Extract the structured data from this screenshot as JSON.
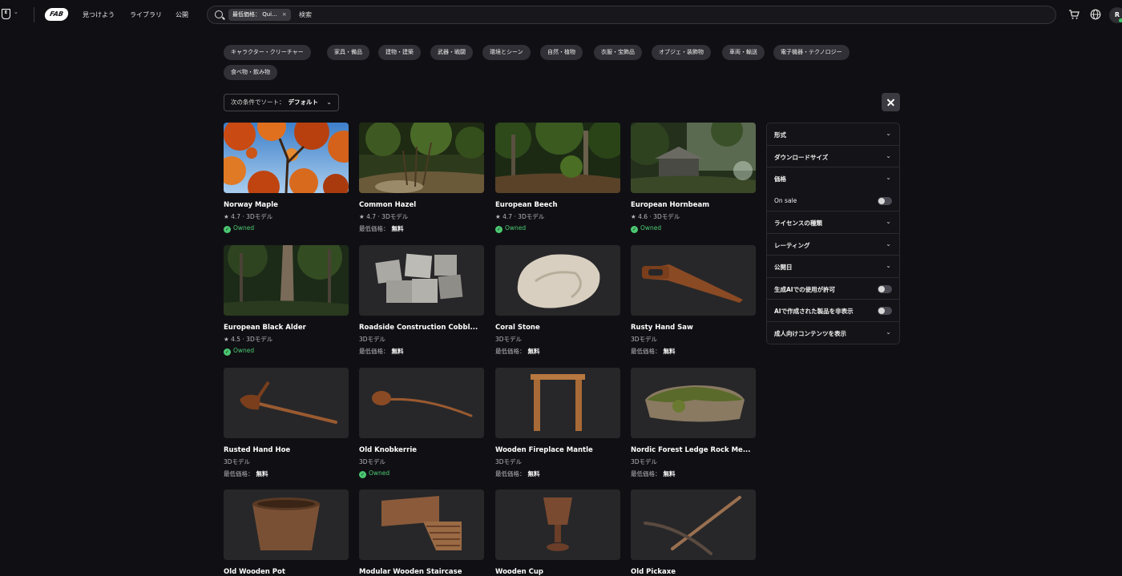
{
  "topbar": {
    "nav": [
      "見つけよう",
      "ライブラリ",
      "公開"
    ],
    "search_chip": "最低価格： Qui...",
    "search_chip_close": "×",
    "search_placeholder": "検索",
    "avatar_letter": "R",
    "logo_text": "FAB"
  },
  "categories": [
    "キャラクター・クリーチャー",
    "家具・備品",
    "建物・建築",
    "武器・戦闘",
    "環境とシーン",
    "自然・植物",
    "衣服・宝飾品",
    "オブジェ・装飾物",
    "車両・輸送",
    "電子機器・テクノロジー",
    "食べ物・飲み物"
  ],
  "sort": {
    "label": "次の条件でソート：",
    "value": "デフォルト"
  },
  "cards": [
    {
      "title": "Norway Maple",
      "meta": "★ 4.7 · 3Dモデル",
      "status": "owned",
      "status_text": "Owned"
    },
    {
      "title": "Common Hazel",
      "meta": "★ 4.7 · 3Dモデル",
      "status": "price",
      "price_label": "最低価格：",
      "price": "無料"
    },
    {
      "title": "European Beech",
      "meta": "★ 4.7 · 3Dモデル",
      "status": "owned",
      "status_text": "Owned"
    },
    {
      "title": "European Hornbeam",
      "meta": "★ 4.6 · 3Dモデル",
      "status": "owned",
      "status_text": "Owned"
    },
    {
      "title": "European Black Alder",
      "meta": "★ 4.5 · 3Dモデル",
      "status": "owned",
      "status_text": "Owned"
    },
    {
      "title": "Roadside Construction Cobbl...",
      "meta": "3Dモデル",
      "status": "price",
      "price_label": "最低価格：",
      "price": "無料"
    },
    {
      "title": "Coral Stone",
      "meta": "3Dモデル",
      "status": "price",
      "price_label": "最低価格：",
      "price": "無料"
    },
    {
      "title": "Rusty Hand Saw",
      "meta": "3Dモデル",
      "status": "price",
      "price_label": "最低価格：",
      "price": "無料"
    },
    {
      "title": "Rusted Hand Hoe",
      "meta": "3Dモデル",
      "status": "price",
      "price_label": "最低価格：",
      "price": "無料"
    },
    {
      "title": "Old Knobkerrie",
      "meta": "3Dモデル",
      "status": "owned",
      "status_text": "Owned"
    },
    {
      "title": "Wooden Fireplace Mantle",
      "meta": "3Dモデル",
      "status": "price",
      "price_label": "最低価格：",
      "price": "無料"
    },
    {
      "title": "Nordic Forest Ledge Rock Me...",
      "meta": "3Dモデル",
      "status": "price",
      "price_label": "最低価格：",
      "price": "無料"
    },
    {
      "title": "Old Wooden Pot",
      "meta": "",
      "status": "none"
    },
    {
      "title": "Modular Wooden Staircase",
      "meta": "",
      "status": "none"
    },
    {
      "title": "Wooden Cup",
      "meta": "",
      "status": "none"
    },
    {
      "title": "Old Pickaxe",
      "meta": "",
      "status": "none"
    }
  ],
  "filters": [
    {
      "label": "形式",
      "kind": "expand"
    },
    {
      "label": "ダウンロードサイズ",
      "kind": "expand"
    },
    {
      "label": "価格",
      "kind": "expand"
    },
    {
      "label": "On sale",
      "kind": "toggle",
      "on": false
    },
    {
      "label": "ライセンスの種類",
      "kind": "expand"
    },
    {
      "label": "レーティング",
      "kind": "expand"
    },
    {
      "label": "公開日",
      "kind": "expand"
    },
    {
      "label": "生成AIでの使用が許可",
      "kind": "toggle",
      "on": false
    },
    {
      "label": "AIで作成された製品を非表示",
      "kind": "toggle",
      "on": false
    },
    {
      "label": "成人向けコンテンツを表示",
      "kind": "expand"
    }
  ],
  "colors": {
    "background": "#101014",
    "owned": "#4cc872",
    "chip": "#303036",
    "panel_border": "#2a2a30"
  }
}
